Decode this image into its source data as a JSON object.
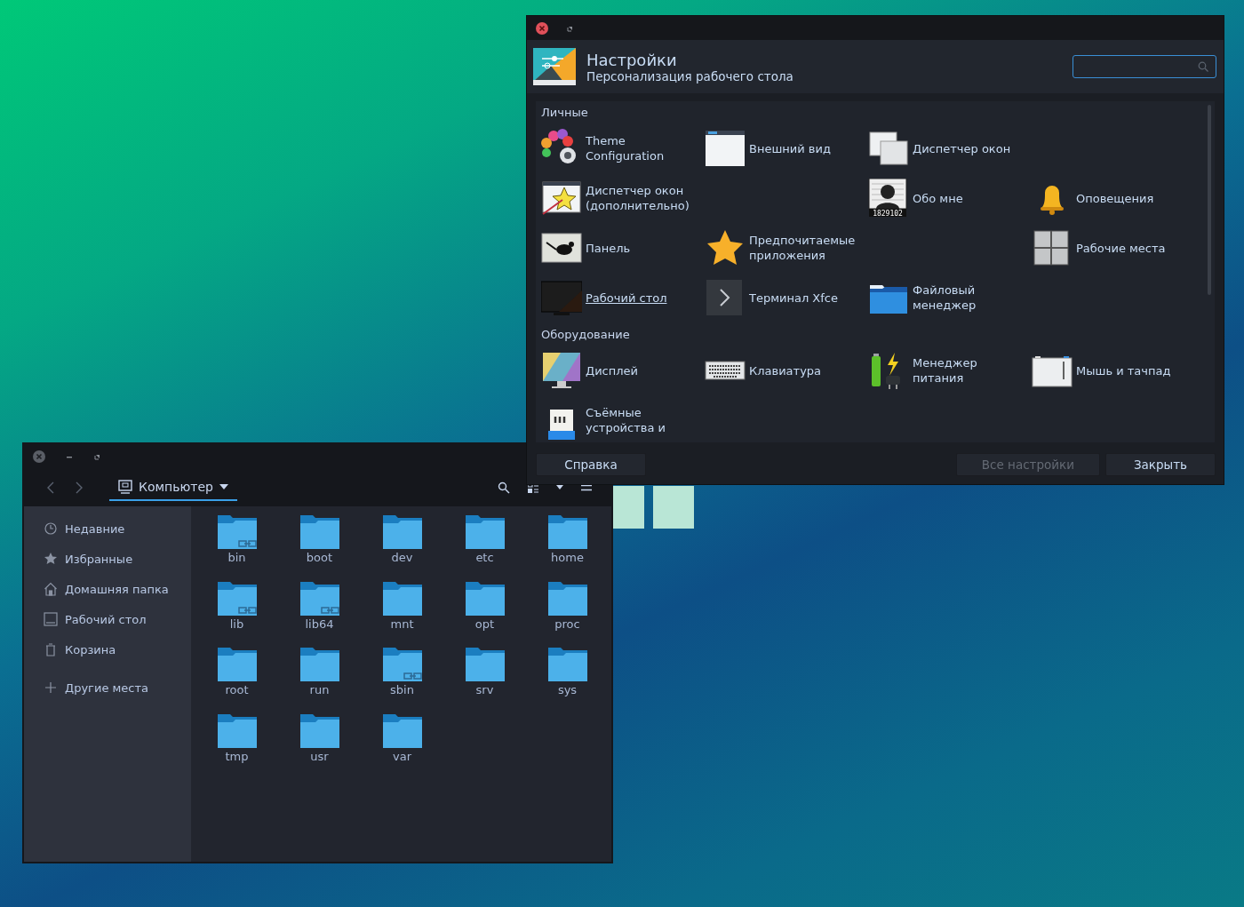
{
  "settings_window": {
    "title": "Настройки",
    "subtitle": "Персонализация рабочего стола",
    "sections": [
      {
        "title": "Личные",
        "items": [
          {
            "label": "Theme Configuration",
            "hovered": false
          },
          {
            "label": "Внешний вид",
            "hovered": false
          },
          {
            "label": "Диспетчер окон",
            "hovered": false
          },
          {
            "label": "Диспетчер окон (дополнительно)",
            "hovered": false
          },
          {
            "label": "Обо мне",
            "hovered": false,
            "icon_text": "1829102"
          },
          {
            "label": "Оповещения",
            "hovered": false
          },
          {
            "label": "Панель",
            "hovered": false
          },
          {
            "label": "Предпочитаемые приложения",
            "hovered": false
          },
          {
            "label": "Рабочие места",
            "hovered": false
          },
          {
            "label": "Рабочий стол",
            "hovered": true
          },
          {
            "label": "Терминал Xfce",
            "hovered": false
          },
          {
            "label": "Файловый менеджер",
            "hovered": false
          }
        ]
      },
      {
        "title": "Оборудование",
        "items": [
          {
            "label": "Дисплей",
            "hovered": false
          },
          {
            "label": "Клавиатура",
            "hovered": false
          },
          {
            "label": "Менеджер питания",
            "hovered": false
          },
          {
            "label": "Мышь и тачпад",
            "hovered": false
          },
          {
            "label": "Съёмные устройства и",
            "hovered": false
          }
        ]
      }
    ],
    "buttons": [
      {
        "label": "Справка",
        "disabled": false
      },
      {
        "label": "Все настройки",
        "disabled": true
      },
      {
        "label": "Закрыть",
        "disabled": false
      }
    ]
  },
  "file_manager": {
    "location": "Компьютер",
    "sidebar": [
      {
        "label": "Недавние"
      },
      {
        "label": "Избранные"
      },
      {
        "label": "Домашняя папка"
      },
      {
        "label": "Рабочий стол"
      },
      {
        "label": "Корзина"
      },
      {
        "label": "Другие места"
      }
    ],
    "folders": [
      {
        "name": "bin",
        "symlink": true
      },
      {
        "name": "boot",
        "symlink": false
      },
      {
        "name": "dev",
        "symlink": false
      },
      {
        "name": "etc",
        "symlink": false
      },
      {
        "name": "home",
        "symlink": false
      },
      {
        "name": "lib",
        "symlink": true
      },
      {
        "name": "lib64",
        "symlink": true
      },
      {
        "name": "mnt",
        "symlink": false
      },
      {
        "name": "opt",
        "symlink": false
      },
      {
        "name": "proc",
        "symlink": false
      },
      {
        "name": "root",
        "symlink": false
      },
      {
        "name": "run",
        "symlink": false
      },
      {
        "name": "sbin",
        "symlink": true
      },
      {
        "name": "srv",
        "symlink": false
      },
      {
        "name": "sys",
        "symlink": false
      },
      {
        "name": "tmp",
        "symlink": false
      },
      {
        "name": "usr",
        "symlink": false
      },
      {
        "name": "var",
        "symlink": false
      }
    ]
  }
}
